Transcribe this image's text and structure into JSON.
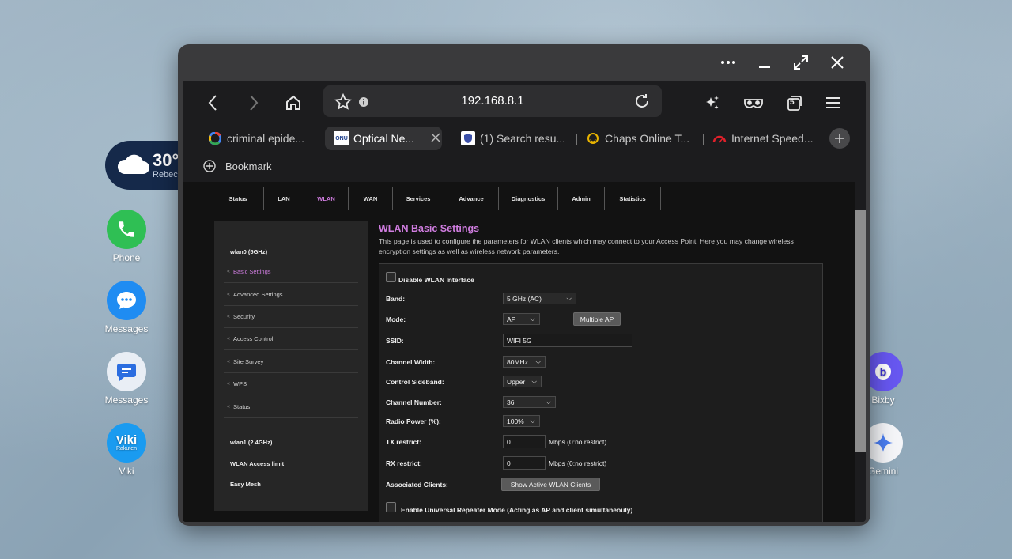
{
  "desktop": {
    "weather": {
      "temp": "30°",
      "city": "Rebec"
    },
    "apps_left": [
      {
        "label": "Phone",
        "color": "#2fbf54"
      },
      {
        "label": "Messages",
        "color": "#1f8cf2"
      },
      {
        "label": "Messages",
        "color": "#e9eef5"
      },
      {
        "label": "Viki",
        "color": "#1a9bf0"
      }
    ],
    "apps_right": [
      {
        "label": "Bixby"
      },
      {
        "label": "Gemini"
      }
    ],
    "viki_logo_top": "Viki",
    "viki_logo_bottom": "Rakuten"
  },
  "browser": {
    "url": "192.168.8.1",
    "tabs": [
      {
        "title": "criminal epide...",
        "icon": "google-icon"
      },
      {
        "title": "Optical Ne...",
        "icon": "onu-icon",
        "active": true
      },
      {
        "title": "(1) Search resu...",
        "icon": "shield-icon"
      },
      {
        "title": "Chaps Online T...",
        "icon": "smiley-icon"
      },
      {
        "title": "Internet Speed...",
        "icon": "speedometer-icon"
      }
    ],
    "bookmark_label": "Bookmark",
    "badge_tab_count": "5"
  },
  "router": {
    "menu": [
      "Status",
      "LAN",
      "WLAN",
      "WAN",
      "Services",
      "Advance",
      "Diagnostics",
      "Admin",
      "Statistics"
    ],
    "active_menu": "WLAN",
    "sidebar": {
      "group1": "wlan0 (5GHz)",
      "items": [
        "Basic Settings",
        "Advanced Settings",
        "Security",
        "Access Control",
        "Site Survey",
        "WPS",
        "Status"
      ],
      "group2": "wlan1 (2.4GHz)",
      "group3": "WLAN Access limit",
      "group4": "Easy Mesh"
    },
    "title": "WLAN Basic Settings",
    "description": "This page is used to configure the parameters for WLAN clients which may connect to your Access Point. Here you may change wireless encryption settings as well as wireless network parameters.",
    "form": {
      "disable_label": "Disable WLAN Interface",
      "band_label": "Band:",
      "band_value": "5 GHz (AC)",
      "mode_label": "Mode:",
      "mode_value": "AP",
      "multiple_ap": "Multiple AP",
      "ssid_label": "SSID:",
      "ssid_value": "WIFI 5G",
      "cw_label": "Channel Width:",
      "cw_value": "80MHz",
      "cs_label": "Control Sideband:",
      "cs_value": "Upper",
      "cn_label": "Channel Number:",
      "cn_value": "36",
      "rp_label": "Radio Power (%):",
      "rp_value": "100%",
      "tx_label": "TX restrict:",
      "tx_value": "0",
      "tx_note": "Mbps (0:no restrict)",
      "rx_label": "RX restrict:",
      "rx_value": "0",
      "rx_note": "Mbps (0:no restrict)",
      "ac_label": "Associated Clients:",
      "ac_button": "Show Active WLAN Clients",
      "repeater_label": "Enable Universal Repeater Mode (Acting as AP and client simultaneouly)"
    }
  }
}
